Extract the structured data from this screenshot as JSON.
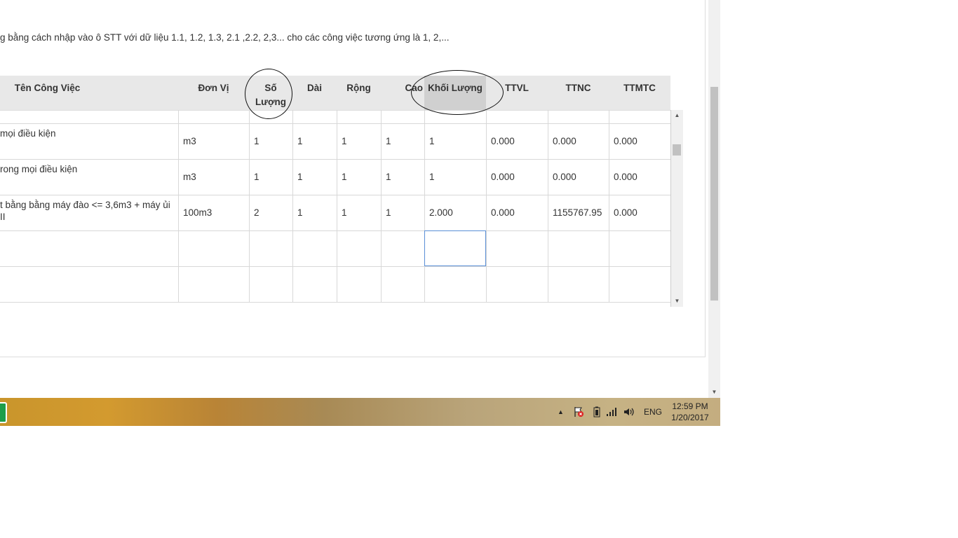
{
  "instruction": "g bằng cách nhập vào ô STT với dữ liệu 1.1, 1.2, 1.3, 2.1 ,2.2, 2,3... cho các công việc tương ứng là 1, 2,...",
  "grid": {
    "columns": [
      {
        "label": "Tên Công Việc"
      },
      {
        "label": "Đơn Vị"
      },
      {
        "label": "Số Lượng"
      },
      {
        "label": "Dài"
      },
      {
        "label": "Rộng"
      },
      {
        "label": "Cao"
      },
      {
        "label": "Khối Lượng"
      },
      {
        "label": "TTVL"
      },
      {
        "label": "TTNC"
      },
      {
        "label": "TTMTC"
      }
    ],
    "rows": [
      {
        "cells": [
          "mọi điều kiện",
          "m3",
          "1",
          "1",
          "1",
          "1",
          "1",
          "0.000",
          "0.000",
          "0.000"
        ]
      },
      {
        "cells": [
          "rong mọi điều kiện",
          "m3",
          "1",
          "1",
          "1",
          "1",
          "1",
          "0.000",
          "0.000",
          "0.000"
        ]
      },
      {
        "cells": [
          "t bằng bằng máy đào <= 3,6m3 + máy ủi\nII",
          "100m3",
          "2",
          "1",
          "1",
          "1",
          "2.000",
          "0.000",
          "1155767.95",
          "0.000"
        ]
      },
      {
        "cells": [
          "",
          "",
          "",
          "",
          "",
          "",
          "",
          "",
          "",
          ""
        ]
      },
      {
        "cells": [
          "",
          "",
          "",
          "",
          "",
          "",
          "",
          "",
          "",
          ""
        ]
      }
    ]
  },
  "taskbar": {
    "tray_arrow": "▲",
    "language": "ENG",
    "time": "12:59 PM",
    "date": "1/20/2017"
  }
}
